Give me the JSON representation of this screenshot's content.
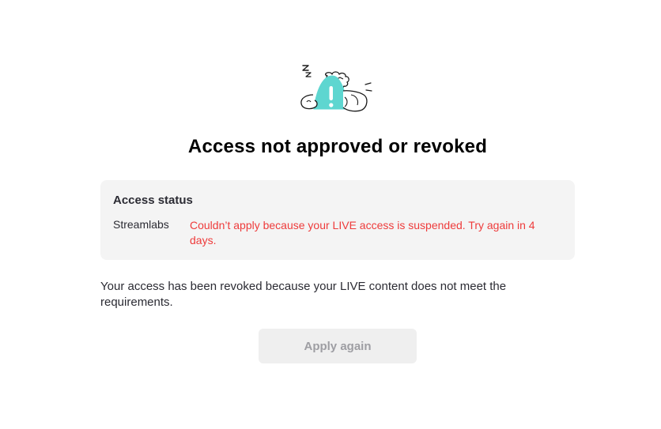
{
  "page": {
    "title": "Access not approved or revoked",
    "description": "Your access has been revoked because your LIVE content does not meet the requirements."
  },
  "status_card": {
    "heading": "Access status",
    "rows": [
      {
        "label": "Streamlabs",
        "message": "Couldn’t apply because your LIVE access is suspended. Try again in 4 days."
      }
    ]
  },
  "actions": {
    "apply_again_label": "Apply again",
    "apply_again_disabled": true
  },
  "colors": {
    "error_text": "#ee3b3b",
    "warning_bell": "#5ed6d0",
    "card_background": "#f4f4f4",
    "button_background": "#efefef",
    "button_text_disabled": "#9e9ea3"
  },
  "icons": {
    "illustration": "sleepy-warning-bell-illustration"
  }
}
